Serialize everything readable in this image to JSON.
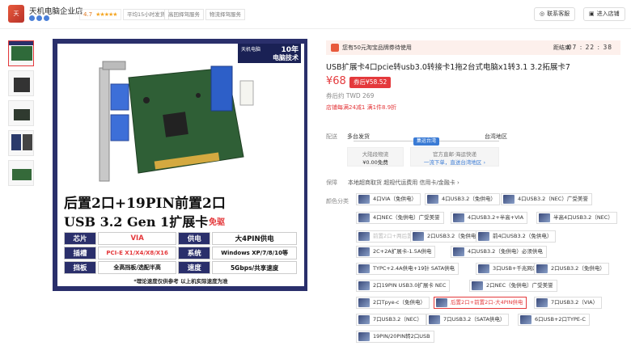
{
  "header": {
    "shop_name": "天机电脑企业店",
    "rating": "4.7",
    "tags": [
      "平均15小时发货",
      "高回择驾服务",
      "物流择驾服务"
    ],
    "contact": "联系客服",
    "enter_shop": "进入店铺"
  },
  "gallery": {
    "brand_logo": "天机电脑",
    "brand_sub": "Computer Games",
    "years": "10年",
    "years_text": "电脑技术",
    "headline1": "后置2口+19PIN前置2口",
    "headline2": "USB 3.2 Gen 1扩展卡",
    "no_driver": "免驱",
    "specs": [
      {
        "k1": "芯片",
        "v1": "VIA",
        "k2": "供电",
        "v2": "大4PIN供电"
      },
      {
        "k1": "插槽",
        "v1": "PCI-E X1/X4/X8/X16",
        "k2": "系统",
        "v2": "Windows XP/7/8/10等"
      },
      {
        "k1": "挡板",
        "v1": "全高挡板/选配半高",
        "k2": "速度",
        "v2": "5Gbps/共享速度"
      }
    ],
    "note": "*理论速度仅供参考  以上机实际速度为准"
  },
  "product": {
    "timer_text": "您有50元淘宝品牌券待使用",
    "timer_label": "距结束",
    "countdown": "07 : 22 : 38",
    "title": "USB扩展卡4口pcie转usb3.0转接卡1拖2台式电脑x1转3.1 3.2拓展卡7",
    "price": "¥68",
    "coupon": "券后¥58.52",
    "prev_price": "券后约 TWD 269",
    "promo": "店铺每满24减1 满1件8.9折"
  },
  "delivery": {
    "label": "配送",
    "from": "多台发货",
    "to": "台湾地区",
    "route_badge": "集运台湾",
    "mainland_label": "大陆段物流",
    "mainland_fee": "¥0.00免费",
    "official_label": "官方直邮·海运快递",
    "official_sub": "一流下单，直送台湾地区 ›"
  },
  "guarantee": {
    "label": "保障",
    "text": "本地超商取货  超规代运费用  信用卡/金融卡 ›"
  },
  "options": {
    "label": "颜色分类",
    "items": [
      "4口VIA（免供电）",
      "4口USB3.2（免供电）",
      "4口USB3.2（NEC）广受美誉",
      "4口NEC（免供电）广受美誉",
      "4口USB3.2+半高+VIA",
      "半高4口USB3.2（NEC）",
      "前置2口+两后置2口",
      "2口USB3.2（免供电）",
      "前4口USB3.2（免供电）",
      "2C+2A扩展卡-1.5A供电",
      "4口USB3.2（免供电）必须供电",
      "TYPC+2.4A供电+19针 SATA供电",
      "3口USB+千兆网口",
      "2口USB3.2（免供电）",
      "2口19PIN USB3.0扩展卡 NEC",
      "2口NEC（免供电）广受美誉",
      "2口Tpye-c（免供电）",
      "后置2口+前置2口-大4PIN供电",
      "7口USB3.2（VIA）",
      "7口USB3.2（NEC）",
      "7口USB3.2（SATA供电）",
      "6口USB+2口TYPE-C",
      "19PIN/20PIN转2口USB"
    ]
  }
}
